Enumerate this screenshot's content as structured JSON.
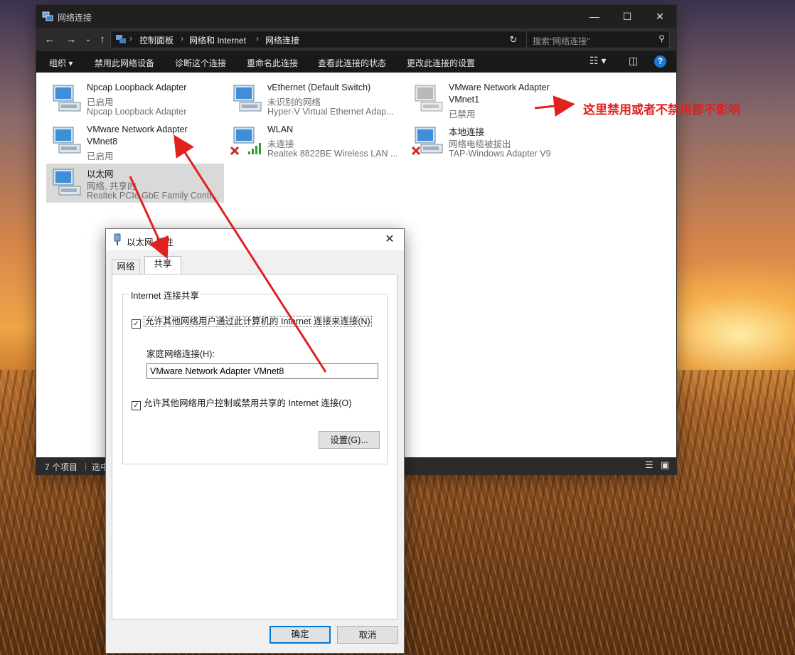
{
  "explorer": {
    "title": "网络连接",
    "breadcrumb": [
      "控制面板",
      "网络和 Internet",
      "网络连接"
    ],
    "search_placeholder": "搜索\"网络连接\"",
    "toolbar": [
      "组织 ▾",
      "禁用此网络设备",
      "诊断这个连接",
      "重命名此连接",
      "查看此连接的状态",
      "更改此连接的设置"
    ],
    "items": [
      {
        "name": "Npcap Loopback Adapter",
        "status": "已启用",
        "device": "Npcap Loopback Adapter"
      },
      {
        "name": "vEthernet (Default Switch)",
        "status": "未识别的网络",
        "device": "Hyper-V Virtual Ethernet Adap..."
      },
      {
        "name": "VMware Network Adapter",
        "name2": "VMnet1",
        "status": "已禁用"
      },
      {
        "name": "VMware Network Adapter",
        "name2": "VMnet8",
        "status": "已启用"
      },
      {
        "name": "WLAN",
        "status": "未连接",
        "device": "Realtek 8822BE Wireless LAN ..."
      },
      {
        "name": "本地连接",
        "status": "网络电缆被拔出",
        "device": "TAP-Windows Adapter V9"
      },
      {
        "name": "以太网",
        "status": "网络, 共享的",
        "device": "Realtek PCIe GbE Family Contr..."
      }
    ],
    "status_count": "7 个项目",
    "status_selected": "选中"
  },
  "dialog": {
    "title": "以太网 属性",
    "tabs": [
      "网络",
      "共享"
    ],
    "group_title": "Internet 连接共享",
    "allow_share": "允许其他网络用户通过此计算机的 Internet 连接来连接(N)",
    "home_label": "家庭网络连接(H):",
    "home_value": "VMware Network Adapter VMnet8",
    "allow_control": "允许其他网络用户控制或禁用共享的 Internet 连接(O)",
    "settings_button": "设置(G)...",
    "ok_button": "确定",
    "cancel_button": "取消"
  },
  "annotation": {
    "text": "这里禁用或者不禁用都不影响",
    "color": "#e1201f"
  },
  "icons": {
    "window": "network-connections-icon",
    "adapter": "network-adapter-icon",
    "disconnected": "red-x-icon",
    "signal": "wifi-signal-icon"
  }
}
